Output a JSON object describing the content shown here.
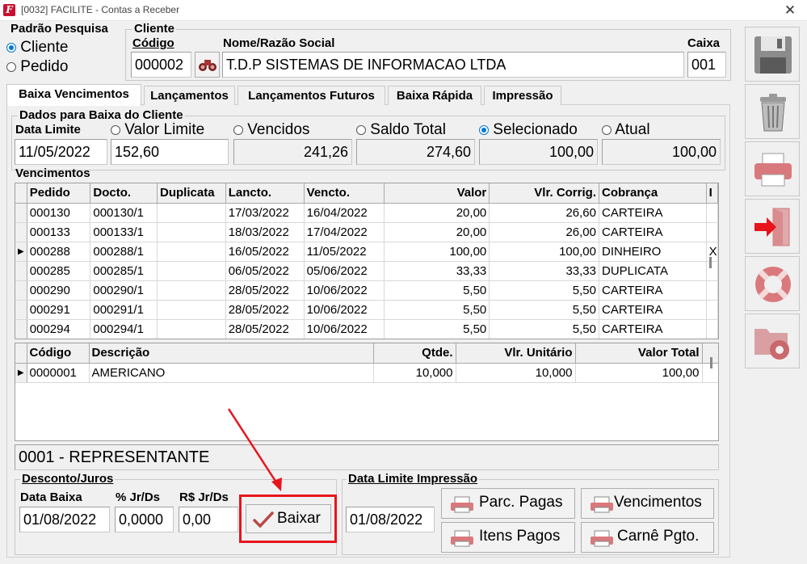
{
  "window": {
    "title": "[0032] FACILITE - Contas a Receber",
    "close": "✕"
  },
  "padrao": {
    "title": "Padrão Pesquisa",
    "options": [
      {
        "label": "Cliente",
        "selected": true
      },
      {
        "label": "Pedido",
        "selected": false
      }
    ]
  },
  "cliente": {
    "title": "Cliente",
    "codigo_label": "Código",
    "codigo": "000002",
    "nome_label": "Nome/Razão Social",
    "nome": "T.D.P SISTEMAS DE INFORMACAO LTDA",
    "caixa_label": "Caixa",
    "caixa": "001"
  },
  "tabs": [
    {
      "label": "Baixa Vencimentos",
      "active": true
    },
    {
      "label": "Lançamentos",
      "active": false
    },
    {
      "label": "Lançamentos Futuros",
      "active": false
    },
    {
      "label": "Baixa Rápida",
      "active": false
    },
    {
      "label": "Impressão",
      "active": false
    }
  ],
  "dados": {
    "title": "Dados para Baixa do Cliente",
    "data_limite_label": "Data Limite",
    "data_limite": "11/05/2022",
    "valor_limite_label": "Valor Limite",
    "valor_limite": "152,60",
    "vencidos_label": "Vencidos",
    "vencidos": "241,26",
    "saldo_total_label": "Saldo Total",
    "saldo_total": "274,60",
    "selecionado_label": "Selecionado",
    "selecionado": "100,00",
    "atual_label": "Atual",
    "atual": "100,00"
  },
  "vencimentos": {
    "title": "Vencimentos",
    "columns": [
      "Pedido",
      "Docto.",
      "Duplicata",
      "Lancto.",
      "Vencto.",
      "Valor",
      "Vlr. Corrig.",
      "Cobrança",
      "I"
    ],
    "rows": [
      {
        "pedido": "000130",
        "docto": "000130/1",
        "duplicata": "",
        "lancto": "17/03/2022",
        "vencto": "16/04/2022",
        "valor": "20,00",
        "corrig": "26,60",
        "cobranca": "CARTEIRA",
        "i": "",
        "current": false
      },
      {
        "pedido": "000133",
        "docto": "000133/1",
        "duplicata": "",
        "lancto": "18/03/2022",
        "vencto": "17/04/2022",
        "valor": "20,00",
        "corrig": "26,00",
        "cobranca": "CARTEIRA",
        "i": "",
        "current": false
      },
      {
        "pedido": "000288",
        "docto": "000288/1",
        "duplicata": "",
        "lancto": "16/05/2022",
        "vencto": "11/05/2022",
        "valor": "100,00",
        "corrig": "100,00",
        "cobranca": "DINHEIRO",
        "i": "X",
        "current": true
      },
      {
        "pedido": "000285",
        "docto": "000285/1",
        "duplicata": "",
        "lancto": "06/05/2022",
        "vencto": "05/06/2022",
        "valor": "33,33",
        "corrig": "33,33",
        "cobranca": "DUPLICATA",
        "i": "",
        "current": false
      },
      {
        "pedido": "000290",
        "docto": "000290/1",
        "duplicata": "",
        "lancto": "28/05/2022",
        "vencto": "10/06/2022",
        "valor": "5,50",
        "corrig": "5,50",
        "cobranca": "CARTEIRA",
        "i": "",
        "current": false
      },
      {
        "pedido": "000291",
        "docto": "000291/1",
        "duplicata": "",
        "lancto": "28/05/2022",
        "vencto": "10/06/2022",
        "valor": "5,50",
        "corrig": "5,50",
        "cobranca": "CARTEIRA",
        "i": "",
        "current": false
      },
      {
        "pedido": "000294",
        "docto": "000294/1",
        "duplicata": "",
        "lancto": "28/05/2022",
        "vencto": "10/06/2022",
        "valor": "5,50",
        "corrig": "5,50",
        "cobranca": "CARTEIRA",
        "i": "",
        "current": false
      }
    ]
  },
  "itens": {
    "columns": [
      "Código",
      "Descrição",
      "Qtde.",
      "Vlr. Unitário",
      "Valor Total"
    ],
    "rows": [
      {
        "codigo": "0000001",
        "descricao": "AMERICANO",
        "qtde": "10,000",
        "unit": "10,000",
        "total": "100,00",
        "current": true
      }
    ]
  },
  "representante": "0001 - REPRESENTANTE",
  "desconto": {
    "title": "Desconto/Juros",
    "data_baixa_label": "Data Baixa",
    "data_baixa": "01/08/2022",
    "jr_pct_label": "% Jr/Ds",
    "jr_pct": "0,0000",
    "jr_rs_label": "R$ Jr/Ds",
    "jr_rs": "0,00",
    "baixar": "Baixar"
  },
  "impressao": {
    "title": "Data Limite Impressão",
    "data": "01/08/2022",
    "buttons": [
      "Parc. Pagas",
      "Vencimentos",
      "Itens Pagos",
      "Carnê Pgto."
    ]
  },
  "sidebar": [
    "save-icon",
    "trash-icon",
    "print-icon",
    "exit-icon",
    "help-icon",
    "settings-icon"
  ],
  "colors": {
    "accent": "#0078d7",
    "highlight": "#e8141c",
    "brand": "#c8102e"
  }
}
